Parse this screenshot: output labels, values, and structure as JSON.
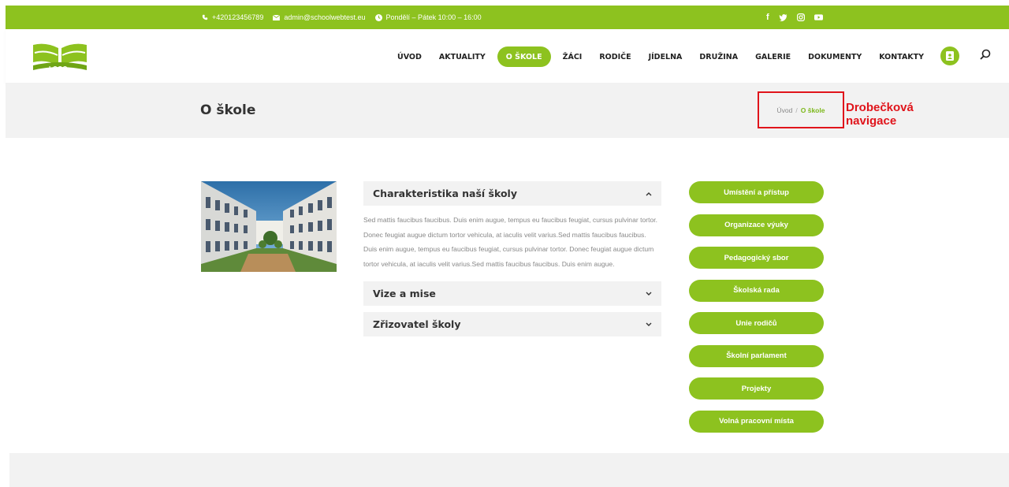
{
  "topbar": {
    "phone": "+420123456789",
    "email": "admin@schoolwebtest.eu",
    "hours": "Pondělí – Pátek 10:00 – 16:00",
    "social_icons": [
      "facebook-icon",
      "twitter-icon",
      "instagram-icon",
      "youtube-icon"
    ]
  },
  "header": {
    "logo_text": "LOGO",
    "nav": [
      {
        "label": "ÚVOD"
      },
      {
        "label": "AKTUALITY"
      },
      {
        "label": "O ŠKOLE",
        "active": true
      },
      {
        "label": "ŽÁCI"
      },
      {
        "label": "RODIČE"
      },
      {
        "label": "JÍDELNA"
      },
      {
        "label": "DRUŽINA"
      },
      {
        "label": "GALERIE"
      },
      {
        "label": "DOKUMENTY"
      },
      {
        "label": "KONTAKTY"
      }
    ]
  },
  "title_bar": {
    "title": "O škole",
    "breadcrumb": {
      "home": "Úvod",
      "separator": "/",
      "current": "O škole"
    },
    "annotation": "Drobečková navigace"
  },
  "accordion": {
    "items": [
      {
        "title": "Charakteristika naší školy",
        "expanded": true,
        "body": "Sed mattis faucibus faucibus. Duis enim augue, tempus eu faucibus feugiat, cursus pulvinar tortor. Donec feugiat augue dictum tortor vehicula, at iaculis velit varius.Sed mattis faucibus faucibus. Duis enim augue, tempus eu faucibus feugiat, cursus pulvinar tortor. Donec feugiat augue dictum tortor vehicula, at iaculis velit varius.Sed mattis faucibus faucibus. Duis enim augue."
      },
      {
        "title": "Vize a mise",
        "expanded": false
      },
      {
        "title": "Zřizovatel školy",
        "expanded": false
      }
    ]
  },
  "side_menu": [
    "Umístění a přístup",
    "Organizace výuky",
    "Pedagogický sbor",
    "Školská rada",
    "Unie rodičů",
    "Školní parlament",
    "Projekty",
    "Volná pracovní místa"
  ],
  "colors": {
    "accent": "#8dc21f",
    "annotation": "#e0141b",
    "panel": "#f2f2f2"
  }
}
